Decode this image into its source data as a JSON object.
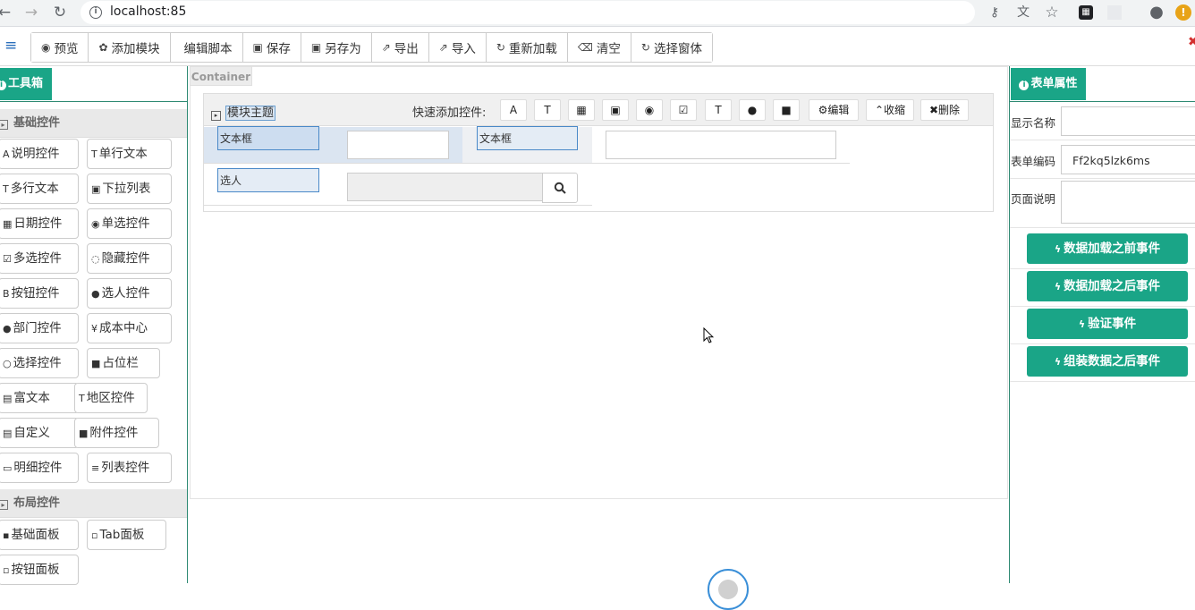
{
  "browser": {
    "url": "localhost:85"
  },
  "toolbar": {
    "buttons": [
      {
        "icon": "eye-icon",
        "label": "预览"
      },
      {
        "icon": "cubes-icon",
        "label": "添加模块"
      },
      {
        "icon": "code-icon",
        "label": "编辑脚本"
      },
      {
        "icon": "save-icon",
        "label": "保存"
      },
      {
        "icon": "save-as-icon",
        "label": "另存为"
      },
      {
        "icon": "export-icon",
        "label": "导出"
      },
      {
        "icon": "import-icon",
        "label": "导入"
      },
      {
        "icon": "refresh-icon",
        "label": "重新加载"
      },
      {
        "icon": "trash-icon",
        "label": "清空"
      },
      {
        "icon": "refresh-icon",
        "label": "选择窗体"
      }
    ]
  },
  "left": {
    "tab": "工具箱",
    "basic_title": "基础控件",
    "basic_items": [
      {
        "glyph": "A",
        "label": "说明控件"
      },
      {
        "glyph": "T",
        "label": "单行文本"
      },
      {
        "glyph": "T",
        "label": "多行文本"
      },
      {
        "glyph": "▣",
        "label": "下拉列表"
      },
      {
        "glyph": "▦",
        "label": "日期控件"
      },
      {
        "glyph": "◉",
        "label": "单选控件"
      },
      {
        "glyph": "☑",
        "label": "多选控件"
      },
      {
        "glyph": "◌",
        "label": "隐藏控件"
      },
      {
        "glyph": "B",
        "label": "按钮控件"
      },
      {
        "glyph": "●",
        "label": "选人控件"
      },
      {
        "glyph": "●",
        "label": "部门控件"
      },
      {
        "glyph": "¥",
        "label": "成本中心"
      },
      {
        "glyph": "○",
        "label": "选择控件"
      },
      {
        "glyph": "■",
        "label": "占位栏"
      },
      {
        "glyph": "▤",
        "label": "富文本"
      },
      {
        "glyph": "T",
        "label": "地区控件"
      },
      {
        "glyph": "▤",
        "label": "自定义"
      },
      {
        "glyph": "■",
        "label": "附件控件"
      },
      {
        "glyph": "▭",
        "label": "明细控件"
      },
      {
        "glyph": "≡",
        "label": "列表控件"
      }
    ],
    "layout_title": "布局控件",
    "layout_items": [
      {
        "glyph": "▪",
        "label": "基础面板"
      },
      {
        "glyph": "▫",
        "label": "Tab面板"
      },
      {
        "glyph": "▫",
        "label": "按钮面板"
      }
    ]
  },
  "center": {
    "container_label": "Container",
    "module_title": "模块主题",
    "quick_add_label": "快速添加控件:",
    "quick_buttons": [
      "A",
      "T",
      "▦",
      "▣",
      "◉",
      "☑",
      "T",
      "●",
      "■"
    ],
    "edit_label": "编辑",
    "collapse_label": "收缩",
    "delete_label": "删除",
    "field1_label": "文本框",
    "field2_label": "文本框",
    "field3_label": "选人"
  },
  "right": {
    "tab": "表单属性",
    "props": [
      {
        "label": "显示名称",
        "value": ""
      },
      {
        "label": "表单编码",
        "value": "Ff2kq5lzk6ms"
      },
      {
        "label": "页面说明",
        "value": ""
      }
    ],
    "events": [
      "数据加载之前事件",
      "数据加载之后事件",
      "验证事件",
      "组装数据之后事件"
    ]
  },
  "colors": {
    "accent": "#1aa587",
    "selection": "#4a89c8"
  }
}
